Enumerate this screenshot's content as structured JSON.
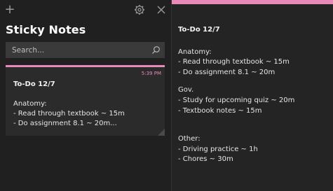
{
  "app": {
    "title": "Sticky Notes"
  },
  "toolbar": {
    "add_symbol": "+"
  },
  "search": {
    "placeholder": "Search..."
  },
  "note_list": [
    {
      "time": "5:39 PM",
      "title": "To-Do 12/7",
      "preview": [
        "Anatomy:",
        "- Read through textbook ~ 15m",
        "- Do assignment 8.1 ~ 20m..."
      ]
    }
  ],
  "editor": {
    "title": "To-Do 12/7",
    "sections": [
      {
        "heading": "Anatomy:",
        "items": [
          "- Read through textbook ~ 15m",
          "- Do assignment 8.1 ~ 20m"
        ]
      },
      {
        "heading": "Gov.",
        "items": [
          "- Study for upcoming quiz ~ 20m",
          "- Textbook notes ~ 15m"
        ]
      },
      {
        "heading": "Other:",
        "items": [
          "- Driving practice ~ 1h",
          "- Chores ~ 30m"
        ]
      }
    ]
  },
  "colors": {
    "accent": "#e889b8",
    "background": "#202020",
    "card": "#2b2b2b"
  },
  "icons": {
    "add": "plus-icon",
    "settings": "gear-icon",
    "close": "close-icon",
    "search": "search-icon"
  }
}
